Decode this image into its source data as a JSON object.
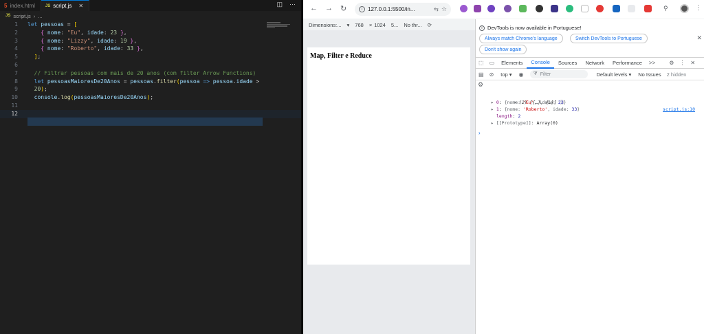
{
  "vscode": {
    "tabs": [
      {
        "icon": "5",
        "label": "index.html",
        "active": false
      },
      {
        "icon": "JS",
        "label": "script.js",
        "active": true
      }
    ],
    "breadcrumb": {
      "icon": "JS",
      "file": "script.js",
      "sep": "›",
      "rest": "..."
    },
    "lines": [
      {
        "n": "1"
      },
      {
        "n": "2"
      },
      {
        "n": "3"
      },
      {
        "n": "4"
      },
      {
        "n": "5"
      },
      {
        "n": "6"
      },
      {
        "n": "7"
      },
      {
        "n": "8"
      },
      {
        "n": "9"
      },
      {
        "n": "10"
      },
      {
        "n": "11"
      },
      {
        "n": "12"
      }
    ],
    "code": {
      "l1_kw": "let",
      "l1_var": " pessoas",
      "l1_op": " = ",
      "l1_br": "[",
      "l2_a": "    ",
      "l2_br": "{",
      "l2_k": " nome",
      "l2_c": ": ",
      "l2_s": "\"Eu\"",
      "l2_d": ", ",
      "l2_k2": "idade",
      "l2_e": ": ",
      "l2_n": "23",
      "l2_f": " ",
      "l2_br2": "}",
      "l2_g": ",",
      "l3_a": "    ",
      "l3_br": "{",
      "l3_k": " nome",
      "l3_c": ": ",
      "l3_s": "\"Lizzy\"",
      "l3_d": ", ",
      "l3_k2": "idade",
      "l3_e": ": ",
      "l3_n": "19",
      "l3_f": " ",
      "l3_br2": "}",
      "l3_g": ",",
      "l4_a": "    ",
      "l4_br": "{",
      "l4_k": " nome",
      "l4_c": ": ",
      "l4_s": "\"Roberto\"",
      "l4_d": ", ",
      "l4_k2": "idade",
      "l4_e": ": ",
      "l4_n": "33",
      "l4_f": " ",
      "l4_br2": "}",
      "l4_g": ",",
      "l5_a": "  ",
      "l5_br": "]",
      "l5_g": ";",
      "l7": "  // Filtrar pessoas com mais de 20 anos (com filter Arrow Functions)",
      "l8_kw": "  let",
      "l8_var": " pessoasMaioresDe20Anos",
      "l8_op": " = ",
      "l8_v2": "pessoas",
      "l8_dot": ".",
      "l8_fn": "filter",
      "l8_br": "(",
      "l8_p": "pessoa",
      "l8_arrow": " => ",
      "l8_v3": "pessoa",
      "l8_dot2": ".",
      "l8_k": "idade",
      "l8_gt": " >",
      "l9_n": "  20",
      "l9_br": ")",
      "l9_g": ";",
      "l10_v": "  console",
      "l10_dot": ".",
      "l10_fn": "log",
      "l10_br": "(",
      "l10_v2": "pessoasMaioresDe20Anos",
      "l10_br2": ")",
      "l10_g": ";"
    }
  },
  "browser": {
    "url": "127.0.0.1:5500/in...",
    "device_toolbar": {
      "dimensions": "Dimensions:...",
      "width": "768",
      "x": "×",
      "height": "1024",
      "zoom": "5...",
      "throttle": "No thr..."
    },
    "page_heading": "Map, Filter e Reduce"
  },
  "devtools": {
    "notice": "DevTools is now available in Portuguese!",
    "btn_match": "Always match Chrome's language",
    "btn_switch": "Switch DevTools to Portuguese",
    "btn_dont": "Don't show again",
    "tabs": [
      "Elements",
      "Console",
      "Sources",
      "Network",
      "Performance"
    ],
    "more": ">>",
    "context": "top",
    "filter_placeholder": "Filter",
    "levels": "Default levels",
    "issues": "No Issues",
    "hidden": "2 hidden",
    "console": {
      "summary": "(2) [{…}, {…}]",
      "source": "script.js:10",
      "items": [
        {
          "idx": "0",
          "name": "'Eu'",
          "age": "23"
        },
        {
          "idx": "1",
          "name": "'Roberto'",
          "age": "33"
        }
      ],
      "length_label": "length",
      "length_value": "2",
      "proto_label": "[[Prototype]]",
      "proto_value": "Array(0)"
    }
  },
  "colors": {
    "accent": "#1a73e8",
    "vscode_bg": "#1f1f1f"
  }
}
